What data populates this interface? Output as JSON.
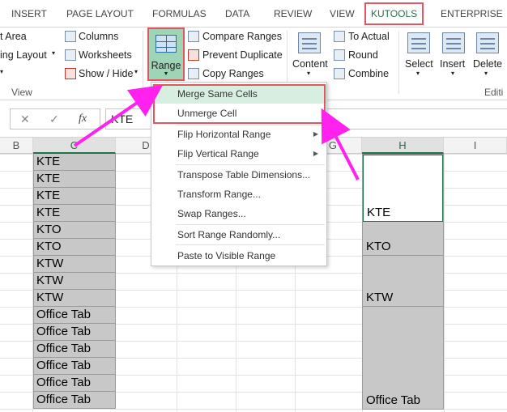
{
  "tabs": [
    "INSERT",
    "PAGE LAYOUT",
    "FORMULAS",
    "DATA",
    "REVIEW",
    "VIEW",
    "KUTOOLS",
    "ENTERPRISE"
  ],
  "ribbon": {
    "view_group": {
      "items": [
        "t Area",
        "ing Layout",
        ""
      ],
      "label": "View"
    },
    "show_group": {
      "columns": "Columns",
      "worksheets": "Worksheets",
      "show_hide": "Show / Hide"
    },
    "range_button": "Range",
    "range_group": {
      "compare": "Compare Ranges",
      "prevent": "Prevent Duplicate",
      "copy": "Copy Ranges"
    },
    "content_button": "Content",
    "content_group": {
      "to_actual": "To Actual",
      "round": "Round",
      "combine": "Combine"
    },
    "select_button": "Select",
    "insert_button": "Insert",
    "delete_button": "Delete",
    "editing_label": "Editi"
  },
  "formula_bar": {
    "value": "KTE",
    "cancel": "✕",
    "enter": "✓",
    "fx": "fx"
  },
  "columns": [
    "B",
    "C",
    "D",
    "G",
    "H",
    "I"
  ],
  "column_c_cells": [
    "KTE",
    "KTE",
    "KTE",
    "KTE",
    "KTO",
    "KTO",
    "KTW",
    "KTW",
    "KTW",
    "Office Tab",
    "Office Tab",
    "Office Tab",
    "Office Tab",
    "Office Tab",
    "Office Tab"
  ],
  "column_h_merged": [
    "KTE",
    "KTO",
    "KTW",
    "Office Tab"
  ],
  "menu": {
    "items": [
      "Merge Same Cells",
      "Unmerge Cell",
      "Flip Horizontal Range",
      "Flip Vertical Range",
      "Transpose Table Dimensions...",
      "Transform Range...",
      "Swap Ranges...",
      "Sort Range Randomly...",
      "Paste to Visible Range"
    ],
    "highlighted_index": 0
  },
  "colors": {
    "accent_green": "#217346",
    "highlight_red": "#e3565f",
    "arrow_magenta": "#ff22ee"
  }
}
